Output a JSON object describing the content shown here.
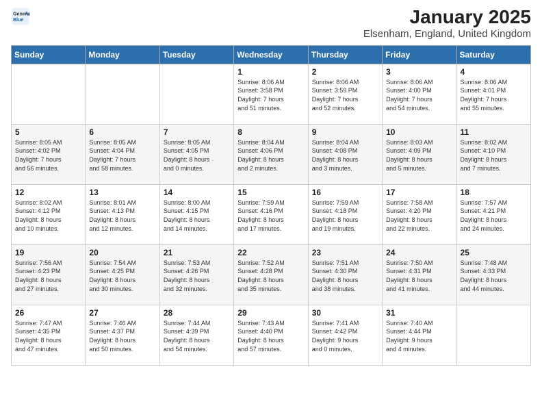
{
  "header": {
    "logo_general": "General",
    "logo_blue": "Blue",
    "title": "January 2025",
    "subtitle": "Elsenham, England, United Kingdom"
  },
  "days_of_week": [
    "Sunday",
    "Monday",
    "Tuesday",
    "Wednesday",
    "Thursday",
    "Friday",
    "Saturday"
  ],
  "weeks": [
    [
      {
        "day": "",
        "info": ""
      },
      {
        "day": "",
        "info": ""
      },
      {
        "day": "",
        "info": ""
      },
      {
        "day": "1",
        "info": "Sunrise: 8:06 AM\nSunset: 3:58 PM\nDaylight: 7 hours\nand 51 minutes."
      },
      {
        "day": "2",
        "info": "Sunrise: 8:06 AM\nSunset: 3:59 PM\nDaylight: 7 hours\nand 52 minutes."
      },
      {
        "day": "3",
        "info": "Sunrise: 8:06 AM\nSunset: 4:00 PM\nDaylight: 7 hours\nand 54 minutes."
      },
      {
        "day": "4",
        "info": "Sunrise: 8:06 AM\nSunset: 4:01 PM\nDaylight: 7 hours\nand 55 minutes."
      }
    ],
    [
      {
        "day": "5",
        "info": "Sunrise: 8:05 AM\nSunset: 4:02 PM\nDaylight: 7 hours\nand 56 minutes."
      },
      {
        "day": "6",
        "info": "Sunrise: 8:05 AM\nSunset: 4:04 PM\nDaylight: 7 hours\nand 58 minutes."
      },
      {
        "day": "7",
        "info": "Sunrise: 8:05 AM\nSunset: 4:05 PM\nDaylight: 8 hours\nand 0 minutes."
      },
      {
        "day": "8",
        "info": "Sunrise: 8:04 AM\nSunset: 4:06 PM\nDaylight: 8 hours\nand 2 minutes."
      },
      {
        "day": "9",
        "info": "Sunrise: 8:04 AM\nSunset: 4:08 PM\nDaylight: 8 hours\nand 3 minutes."
      },
      {
        "day": "10",
        "info": "Sunrise: 8:03 AM\nSunset: 4:09 PM\nDaylight: 8 hours\nand 5 minutes."
      },
      {
        "day": "11",
        "info": "Sunrise: 8:02 AM\nSunset: 4:10 PM\nDaylight: 8 hours\nand 7 minutes."
      }
    ],
    [
      {
        "day": "12",
        "info": "Sunrise: 8:02 AM\nSunset: 4:12 PM\nDaylight: 8 hours\nand 10 minutes."
      },
      {
        "day": "13",
        "info": "Sunrise: 8:01 AM\nSunset: 4:13 PM\nDaylight: 8 hours\nand 12 minutes."
      },
      {
        "day": "14",
        "info": "Sunrise: 8:00 AM\nSunset: 4:15 PM\nDaylight: 8 hours\nand 14 minutes."
      },
      {
        "day": "15",
        "info": "Sunrise: 7:59 AM\nSunset: 4:16 PM\nDaylight: 8 hours\nand 17 minutes."
      },
      {
        "day": "16",
        "info": "Sunrise: 7:59 AM\nSunset: 4:18 PM\nDaylight: 8 hours\nand 19 minutes."
      },
      {
        "day": "17",
        "info": "Sunrise: 7:58 AM\nSunset: 4:20 PM\nDaylight: 8 hours\nand 22 minutes."
      },
      {
        "day": "18",
        "info": "Sunrise: 7:57 AM\nSunset: 4:21 PM\nDaylight: 8 hours\nand 24 minutes."
      }
    ],
    [
      {
        "day": "19",
        "info": "Sunrise: 7:56 AM\nSunset: 4:23 PM\nDaylight: 8 hours\nand 27 minutes."
      },
      {
        "day": "20",
        "info": "Sunrise: 7:54 AM\nSunset: 4:25 PM\nDaylight: 8 hours\nand 30 minutes."
      },
      {
        "day": "21",
        "info": "Sunrise: 7:53 AM\nSunset: 4:26 PM\nDaylight: 8 hours\nand 32 minutes."
      },
      {
        "day": "22",
        "info": "Sunrise: 7:52 AM\nSunset: 4:28 PM\nDaylight: 8 hours\nand 35 minutes."
      },
      {
        "day": "23",
        "info": "Sunrise: 7:51 AM\nSunset: 4:30 PM\nDaylight: 8 hours\nand 38 minutes."
      },
      {
        "day": "24",
        "info": "Sunrise: 7:50 AM\nSunset: 4:31 PM\nDaylight: 8 hours\nand 41 minutes."
      },
      {
        "day": "25",
        "info": "Sunrise: 7:48 AM\nSunset: 4:33 PM\nDaylight: 8 hours\nand 44 minutes."
      }
    ],
    [
      {
        "day": "26",
        "info": "Sunrise: 7:47 AM\nSunset: 4:35 PM\nDaylight: 8 hours\nand 47 minutes."
      },
      {
        "day": "27",
        "info": "Sunrise: 7:46 AM\nSunset: 4:37 PM\nDaylight: 8 hours\nand 50 minutes."
      },
      {
        "day": "28",
        "info": "Sunrise: 7:44 AM\nSunset: 4:39 PM\nDaylight: 8 hours\nand 54 minutes."
      },
      {
        "day": "29",
        "info": "Sunrise: 7:43 AM\nSunset: 4:40 PM\nDaylight: 8 hours\nand 57 minutes."
      },
      {
        "day": "30",
        "info": "Sunrise: 7:41 AM\nSunset: 4:42 PM\nDaylight: 9 hours\nand 0 minutes."
      },
      {
        "day": "31",
        "info": "Sunrise: 7:40 AM\nSunset: 4:44 PM\nDaylight: 9 hours\nand 4 minutes."
      },
      {
        "day": "",
        "info": ""
      }
    ]
  ]
}
